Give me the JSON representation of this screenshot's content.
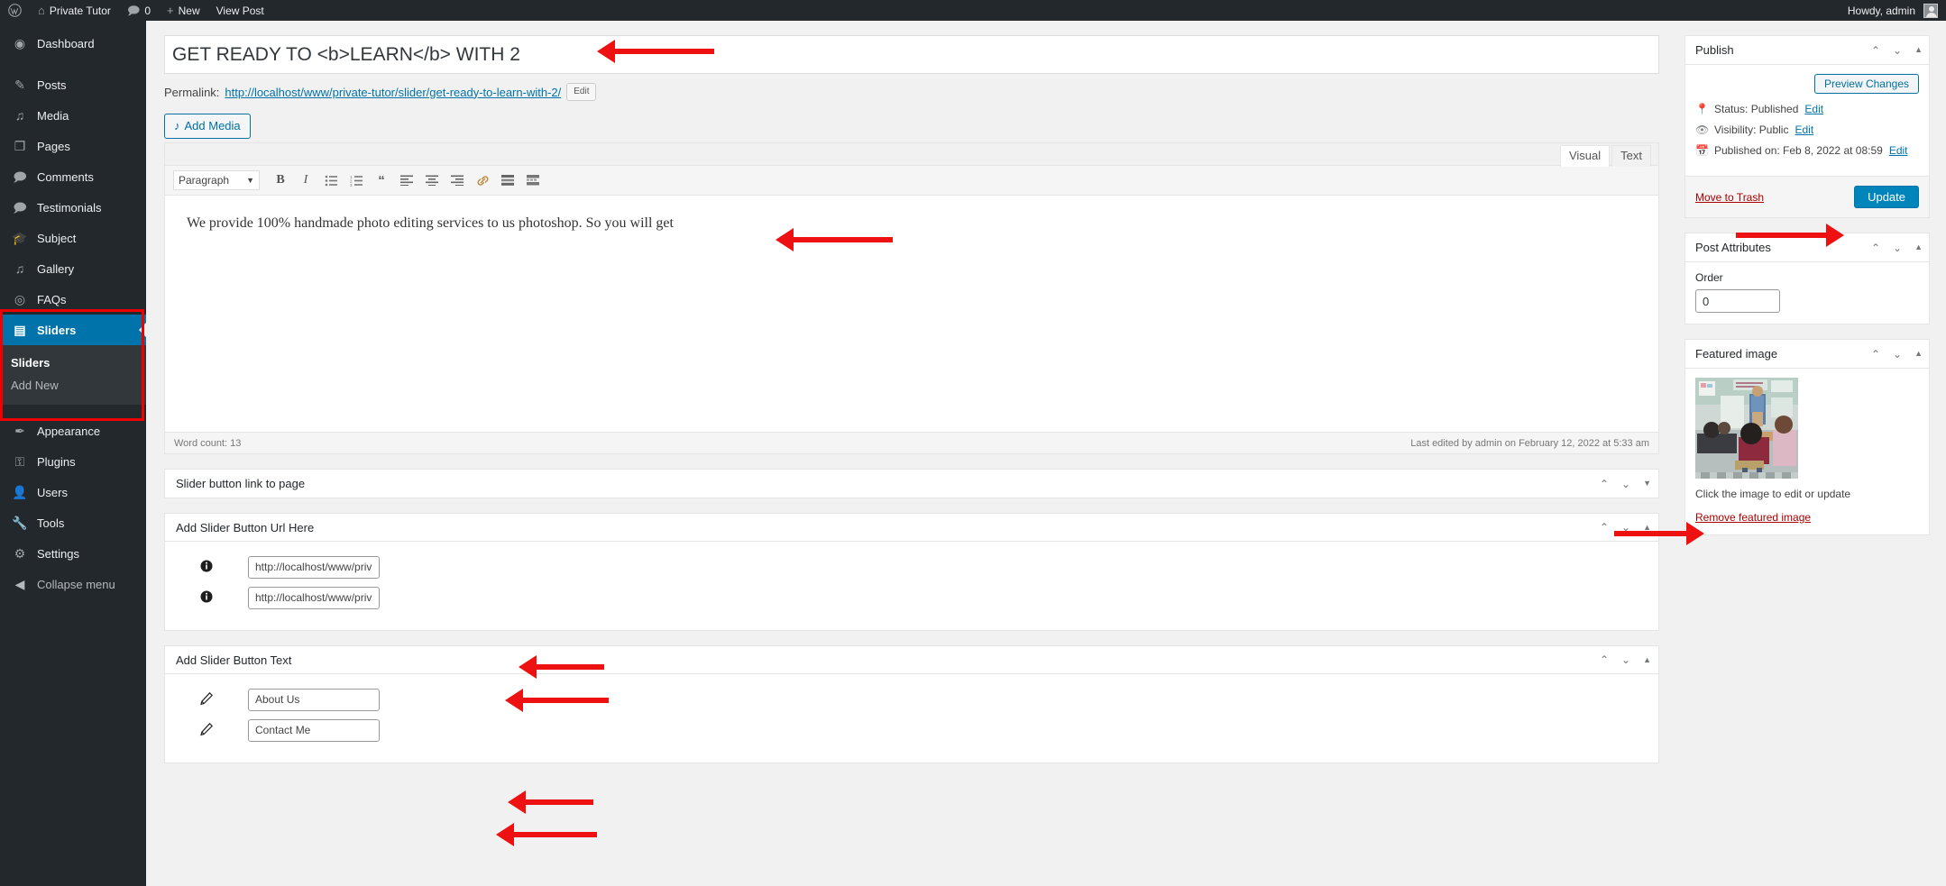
{
  "adminbar": {
    "logo_icon": "wordpress-logo-icon",
    "site_icon": "home-icon",
    "site_name": "Private Tutor",
    "comments_icon": "comment-bubble-icon",
    "comments_count": "0",
    "new_icon": "plus-icon",
    "new_label": "New",
    "view_post_label": "View Post",
    "howdy": "Howdy, admin"
  },
  "sidebar": {
    "items": [
      {
        "label": "Dashboard",
        "icon": "dashboard-icon",
        "glyph": "◉"
      },
      {
        "label": "Posts",
        "icon": "pin-icon",
        "glyph": "✎"
      },
      {
        "label": "Media",
        "icon": "media-icon",
        "glyph": "♪"
      },
      {
        "label": "Pages",
        "icon": "page-icon",
        "glyph": "❐"
      },
      {
        "label": "Comments",
        "icon": "comment-icon",
        "glyph": "🗨"
      },
      {
        "label": "Testimonials",
        "icon": "testimonials-icon",
        "glyph": "❝"
      },
      {
        "label": "Subject",
        "icon": "subject-icon",
        "glyph": "🎓"
      },
      {
        "label": "Gallery",
        "icon": "gallery-icon",
        "glyph": "♪"
      },
      {
        "label": "FAQs",
        "icon": "faq-icon",
        "glyph": "◎"
      },
      {
        "label": "Sliders",
        "icon": "sliders-icon",
        "glyph": "▤"
      },
      {
        "label": "Appearance",
        "icon": "brush-icon",
        "glyph": "✒"
      },
      {
        "label": "Plugins",
        "icon": "plugin-icon",
        "glyph": "⚿"
      },
      {
        "label": "Users",
        "icon": "user-icon",
        "glyph": "👤"
      },
      {
        "label": "Tools",
        "icon": "wrench-icon",
        "glyph": "🔧"
      },
      {
        "label": "Settings",
        "icon": "settings-icon",
        "glyph": "⚙"
      }
    ],
    "sliders_submenu": [
      {
        "label": "Sliders",
        "current": true
      },
      {
        "label": "Add New",
        "current": false
      }
    ],
    "collapse": {
      "label": "Collapse menu",
      "icon": "collapse-arrow-icon"
    },
    "highlight_color": "#0073aa",
    "annotation_color": "#ee0000"
  },
  "editor": {
    "title_value": "GET READY TO <b>LEARN</b> WITH 2",
    "permalink_label": "Permalink:",
    "permalink_url": "http://localhost/www/private-tutor/slider/get-ready-to-learn-with-2/",
    "permalink_edit": "Edit",
    "add_media_label": "Add Media",
    "add_media_icon": "media-add-icon",
    "tabs": [
      {
        "label": "Visual",
        "active": true
      },
      {
        "label": "Text",
        "active": false
      }
    ],
    "format_select": "Paragraph",
    "toolbar": [
      {
        "name": "bold-icon",
        "glyph": "B"
      },
      {
        "name": "italic-icon",
        "glyph": "I"
      },
      {
        "name": "bulleted-list-icon",
        "glyph": "☰"
      },
      {
        "name": "numbered-list-icon",
        "glyph": "☰"
      },
      {
        "name": "blockquote-icon",
        "glyph": "❝"
      },
      {
        "name": "align-left-icon",
        "glyph": "≡"
      },
      {
        "name": "align-center-icon",
        "glyph": "≡"
      },
      {
        "name": "align-right-icon",
        "glyph": "≡"
      },
      {
        "name": "insert-link-icon",
        "glyph": "🔗"
      },
      {
        "name": "read-more-icon",
        "glyph": "▬"
      },
      {
        "name": "toolbar-toggle-icon",
        "glyph": "▤"
      }
    ],
    "content": "We provide 100% handmade photo editing services to us photoshop. So you will get",
    "word_count": "Word count: 13",
    "last_edited": "Last edited by admin on February 12, 2022 at 5:33 am"
  },
  "metaboxes": [
    {
      "title": "Slider button link to page",
      "collapsed": true,
      "toggle_icon": "triangle-down-icon",
      "toggle_glyph": "▼",
      "rows": []
    },
    {
      "title": "Add Slider Button Url Here",
      "collapsed": false,
      "toggle_icon": "triangle-up-icon",
      "toggle_glyph": "▲",
      "rows": [
        {
          "icon": "info-icon",
          "glyph": "ℹ",
          "value": "http://localhost/www/priv"
        },
        {
          "icon": "info-icon",
          "glyph": "ℹ",
          "value": "http://localhost/www/priv"
        }
      ]
    },
    {
      "title": "Add Slider Button Text",
      "collapsed": false,
      "toggle_icon": "triangle-up-icon",
      "toggle_glyph": "▲",
      "rows": [
        {
          "icon": "pencil-icon",
          "glyph": "✎",
          "value": "About Us"
        },
        {
          "icon": "pencil-icon",
          "glyph": "✎",
          "value": "Contact Me"
        }
      ]
    }
  ],
  "publish": {
    "title": "Publish",
    "preview_label": "Preview Changes",
    "status_icon": "pin-marker-icon",
    "status_text": "Status: Published",
    "status_edit": "Edit",
    "visibility_icon": "eye-icon",
    "visibility_text": "Visibility: Public",
    "visibility_edit": "Edit",
    "published_icon": "calendar-icon",
    "published_text": "Published on: Feb 8, 2022 at 08:59",
    "published_edit": "Edit",
    "trash_label": "Move to Trash",
    "update_label": "Update",
    "update_color": "#0085ba"
  },
  "post_attributes": {
    "title": "Post Attributes",
    "order_label": "Order",
    "order_value": "0"
  },
  "featured_image": {
    "title": "Featured image",
    "thumb_icon": "classroom-photo-thumbnail",
    "caption": "Click the image to edit or update",
    "remove_label": "Remove featured image"
  },
  "panel_controls": {
    "up_glyph": "⌃",
    "down_glyph": "⌄",
    "tri_up_glyph": "▲"
  }
}
